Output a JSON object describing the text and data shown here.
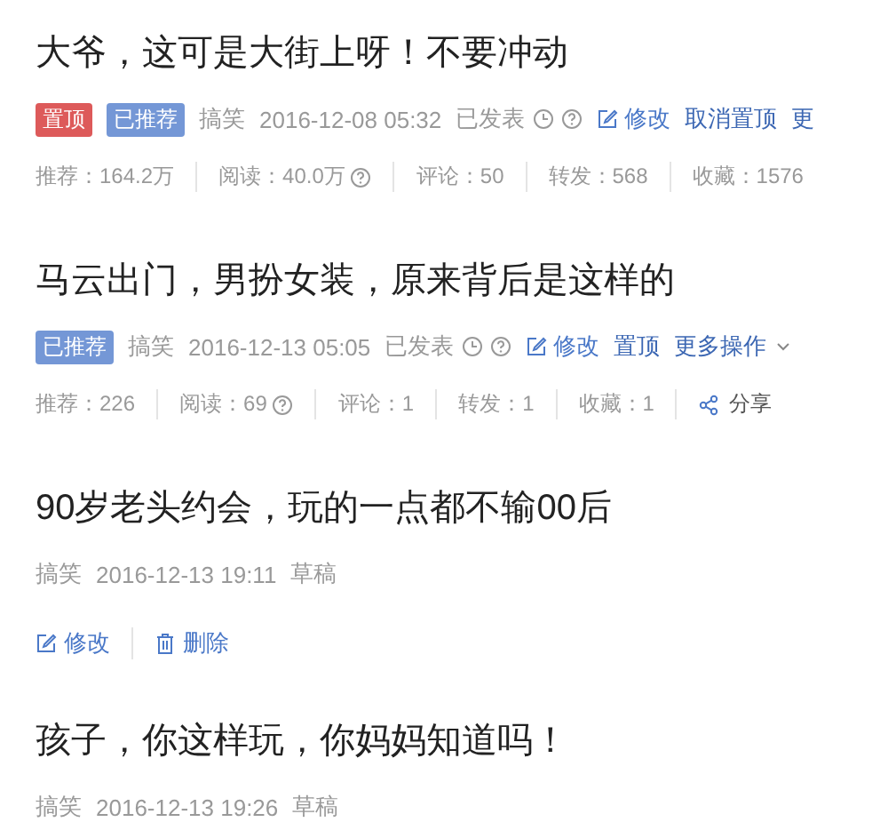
{
  "articles": [
    {
      "title": "大爷，这可是大街上呀！不要冲动",
      "tags": [
        {
          "label": "置顶",
          "color": "#dd5a5a"
        },
        {
          "label": "已推荐",
          "color": "#7497d6"
        }
      ],
      "category": "搞笑",
      "date": "2016-12-08 05:32",
      "status": "已发表",
      "status_info": true,
      "actions": [
        {
          "label": "修改",
          "kind": "edit"
        },
        {
          "label": "取消置顶",
          "kind": "text"
        },
        {
          "label": "更",
          "kind": "text"
        }
      ],
      "stats": [
        {
          "label": "推荐：164.2万",
          "kind": "stat"
        },
        {
          "label": "阅读：40.0万",
          "kind": "help"
        },
        {
          "label": "评论：50",
          "kind": "stat"
        },
        {
          "label": "转发：568",
          "kind": "stat"
        },
        {
          "label": "收藏：1576",
          "kind": "stat"
        }
      ]
    },
    {
      "title": "马云出门，男扮女装，原来背后是这样的",
      "tags": [
        {
          "label": "已推荐",
          "color": "#7497d6"
        }
      ],
      "category": "搞笑",
      "date": "2016-12-13 05:05",
      "status": "已发表",
      "status_info": true,
      "actions": [
        {
          "label": "修改",
          "kind": "edit"
        },
        {
          "label": "置顶",
          "kind": "text"
        },
        {
          "label": "更多操作",
          "kind": "more"
        }
      ],
      "stats": [
        {
          "label": "推荐：226",
          "kind": "stat"
        },
        {
          "label": "阅读：69",
          "kind": "help"
        },
        {
          "label": "评论：1",
          "kind": "stat"
        },
        {
          "label": "转发：1",
          "kind": "stat"
        },
        {
          "label": "收藏：1",
          "kind": "stat"
        },
        {
          "label": "分享",
          "kind": "share"
        }
      ]
    },
    {
      "title": "90岁老头约会，玩的一点都不输00后",
      "category": "搞笑",
      "date": "2016-12-13 19:11",
      "status": "草稿",
      "status_info": false,
      "footer_actions": [
        {
          "label": "修改",
          "kind": "edit"
        },
        {
          "label": "删除",
          "kind": "delete"
        }
      ]
    },
    {
      "title": "孩子，你这样玩，你妈妈知道吗！",
      "category": "搞笑",
      "date": "2016-12-13 19:26",
      "status": "草稿",
      "status_info": false
    }
  ]
}
